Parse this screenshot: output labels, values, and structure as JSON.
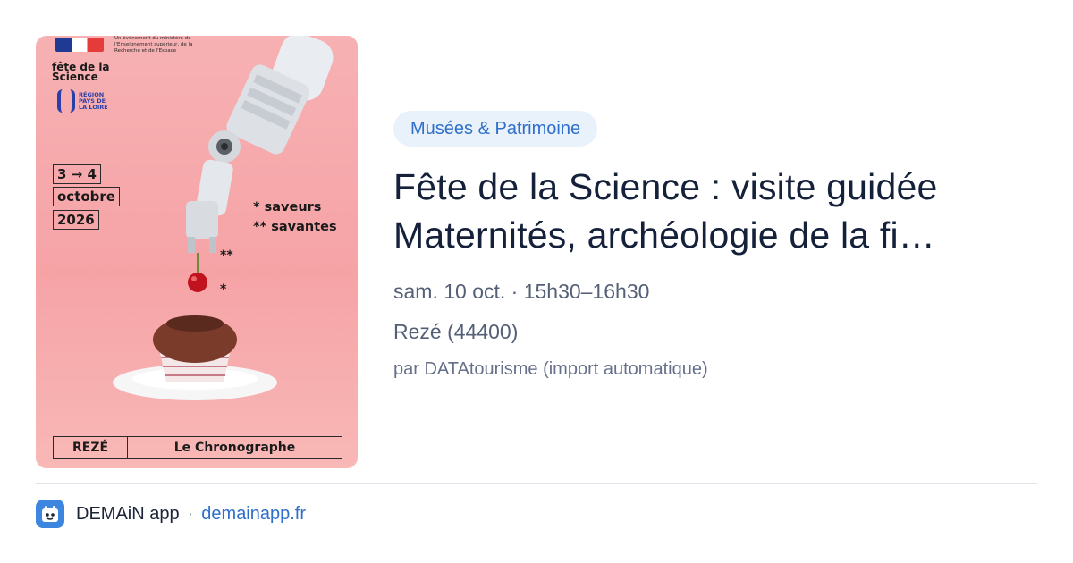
{
  "poster": {
    "ministry_text": "Un événement du ministère de l'Enseignement supérieur, de la Recherche et de l'Espace",
    "festival_name": "fête de la Science",
    "region_text": "RÉGION PAYS DE LA LOIRE",
    "date_line1": "3 → 4",
    "date_line2": "octobre",
    "date_line3": "2026",
    "tagline_line1": "* saveurs",
    "tagline_line2": "** savantes",
    "asterisk_double": "**",
    "asterisk_single": "*",
    "footer_place": "REZÉ",
    "footer_venue": "Le Chronographe"
  },
  "event": {
    "category": "Musées & Patrimoine",
    "title": "Fête de la Science : visite guidée Maternités, archéologie de la fi…",
    "datetime": "sam. 10 oct. · 15h30–16h30",
    "location": "Rezé (44400)",
    "source": "par DATAtourisme (import automatique)"
  },
  "footer": {
    "app_name": "DEMAiN app",
    "separator": "·",
    "domain": "demainapp.fr",
    "icon": "demain-app-icon"
  },
  "colors": {
    "accent": "#2f6fca",
    "badge_bg": "#e9f1fb",
    "poster_bg": "#f6a3a6",
    "title": "#15213a",
    "meta": "#556077"
  }
}
